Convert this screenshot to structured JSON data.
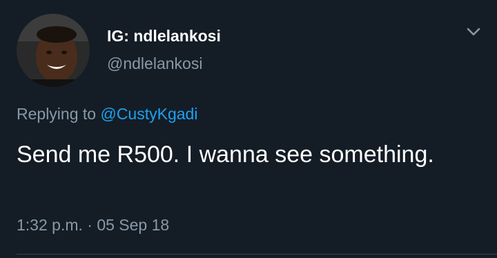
{
  "tweet": {
    "author": {
      "display_name": "IG: ndlelankosi",
      "handle": "@ndlelankosi",
      "avatar_icon": "profile-photo"
    },
    "reply": {
      "prefix": "Replying to",
      "mention": "@CustyKgadi"
    },
    "text": "Send me R500. I wanna see something.",
    "timestamp": "1:32 p.m. · 05 Sep 18",
    "menu_icon": "chevron-down-icon"
  },
  "colors": {
    "background": "#141d26",
    "primary_text": "#ffffff",
    "secondary_text": "#8899a6",
    "link": "#1da1f2",
    "divider": "#38444d"
  }
}
